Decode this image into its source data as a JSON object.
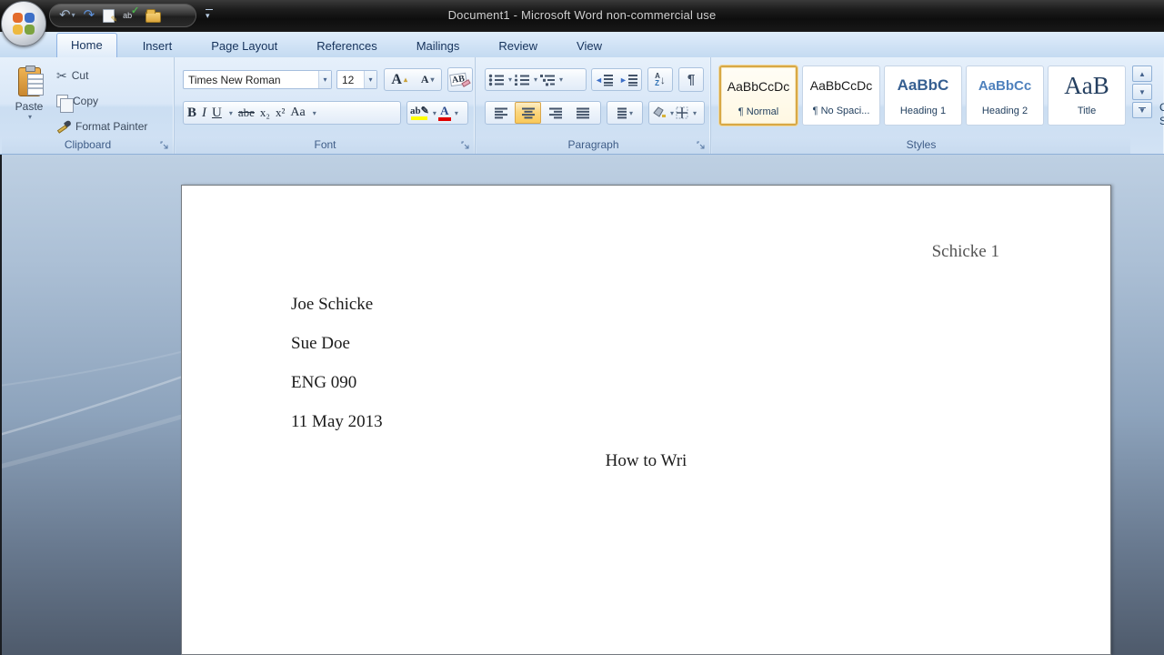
{
  "window": {
    "title": "Document1 - Microsoft Word non-commercial use"
  },
  "tabs": [
    {
      "label": "Home",
      "active": true
    },
    {
      "label": "Insert"
    },
    {
      "label": "Page Layout"
    },
    {
      "label": "References"
    },
    {
      "label": "Mailings"
    },
    {
      "label": "Review"
    },
    {
      "label": "View"
    }
  ],
  "ribbon": {
    "clipboard": {
      "label": "Clipboard",
      "paste": "Paste",
      "cut": "Cut",
      "copy": "Copy",
      "format_painter": "Format Painter"
    },
    "font": {
      "label": "Font",
      "family": "Times New Roman",
      "size": "12",
      "bold": "B",
      "italic": "I",
      "underline": "U",
      "strikethrough": "abe",
      "subscript": "x₂",
      "superscript": "x²",
      "change_case": "Aa",
      "grow": "A",
      "shrink": "A",
      "clear": "AB",
      "highlight": "ab",
      "font_color": "A"
    },
    "paragraph": {
      "label": "Paragraph",
      "sort_a": "A",
      "sort_z": "Z",
      "pilcrow": "¶"
    },
    "styles": {
      "label": "Styles",
      "items": [
        {
          "sample": "AaBbCcDc",
          "name": "¶ Normal",
          "selected": true
        },
        {
          "sample": "AaBbCcDc",
          "name": "¶ No Spaci..."
        },
        {
          "sample": "AaBbC",
          "name": "Heading 1"
        },
        {
          "sample": "AaBbCc",
          "name": "Heading 2"
        },
        {
          "sample": "AaB",
          "name": "Title"
        }
      ],
      "clipped_change_styles": [
        "C",
        "S"
      ]
    }
  },
  "icons": {
    "dropdown": "▾",
    "up_small": "▴",
    "undo": "↶",
    "redo": "↷",
    "pencil": "✎",
    "check": "✓",
    "cut": "✂",
    "spell_letters": "ab",
    "indent_decrease": "◄",
    "indent_increase": "►",
    "sort_arrow": "↓",
    "scroll_up": "▲",
    "scroll_down": "▼"
  },
  "document": {
    "header": "Schicke 1",
    "lines": [
      "Joe Schicke",
      "Sue Doe",
      "ENG 090",
      "11 May 2013"
    ],
    "title_line": "How to Wri"
  },
  "colors": {
    "selection_amber": "#f9c959",
    "heading1": "#365F91",
    "heading2": "#4F81BD",
    "title_style": "#243F60",
    "highlight_yellow": "#ffff00",
    "font_color_red": "#e00000"
  }
}
